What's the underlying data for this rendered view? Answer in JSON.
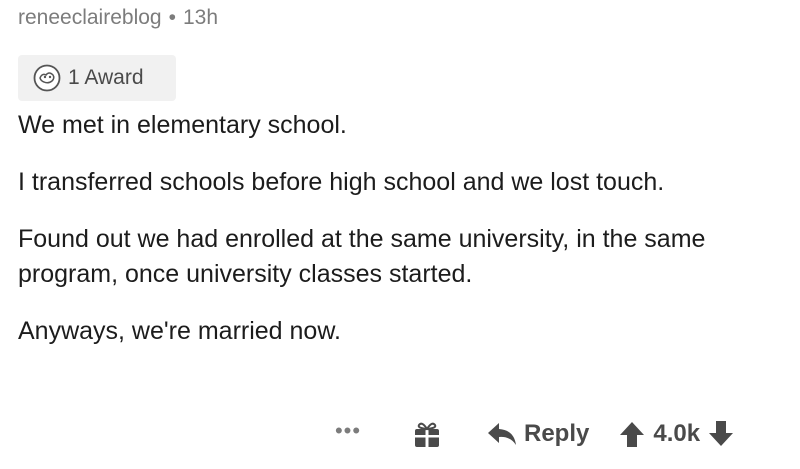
{
  "comment": {
    "author": "reneeclaireblog",
    "separator": "•",
    "time": "13h",
    "award_label": "1 Award",
    "award_icon": "silver-award-icon",
    "paragraphs": [
      "We met in elementary school.",
      "I transferred schools before high school and we lost touch.",
      "Found out we had enrolled at the same university, in the same program, once university classes started.",
      "Anyways, we're married now."
    ]
  },
  "actions": {
    "more_label": "•••",
    "reply_label": "Reply",
    "score": "4.0k",
    "icons": {
      "more": "more-options-icon",
      "gift": "gift-icon",
      "reply": "reply-arrow-icon",
      "upvote": "upvote-arrow-icon",
      "downvote": "downvote-arrow-icon"
    }
  }
}
